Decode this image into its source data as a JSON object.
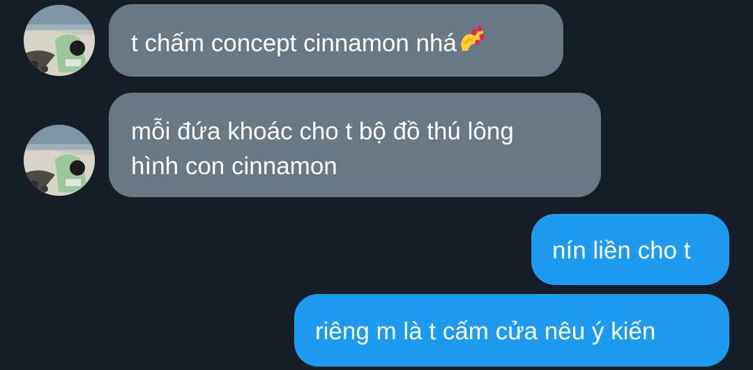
{
  "conversation": {
    "messages": [
      {
        "direction": "incoming",
        "lines": [
          "t chấm concept cinnamon nhá"
        ],
        "emoji": "nail-polish-icon"
      },
      {
        "direction": "incoming",
        "lines": [
          "mỗi đứa khoác cho t bộ đồ thú lông",
          "hình con cinnamon"
        ]
      },
      {
        "direction": "outgoing",
        "lines": [
          "nín liền cho t"
        ]
      },
      {
        "direction": "outgoing",
        "lines": [
          "riêng m là t cấm cửa nêu ý kiến"
        ]
      }
    ]
  },
  "colors": {
    "background": "#151d26",
    "incoming_bubble": "#687885",
    "outgoing_bubble": "#1d9bf0",
    "text": "#ffffff"
  }
}
